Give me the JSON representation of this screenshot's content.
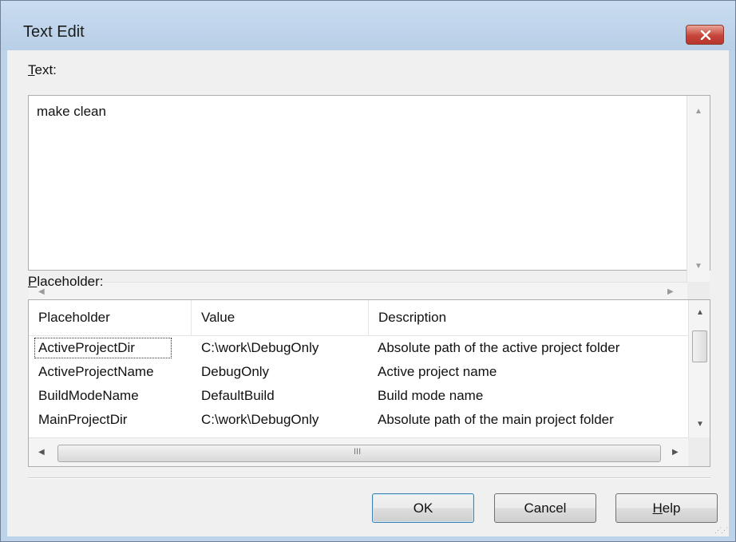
{
  "window": {
    "title": "Text Edit"
  },
  "text_section": {
    "label_underlined": "T",
    "label_rest": "ext:",
    "content": "make clean"
  },
  "placeholder_section": {
    "label_underlined": "P",
    "label_rest": "laceholder:",
    "columns": [
      "Placeholder",
      "Value",
      "Description"
    ],
    "rows": [
      {
        "placeholder": "ActiveProjectDir",
        "value": "C:\\work\\DebugOnly",
        "description": "Absolute path of the active project folder"
      },
      {
        "placeholder": "ActiveProjectName",
        "value": "DebugOnly",
        "description": "Active project name"
      },
      {
        "placeholder": "BuildModeName",
        "value": "DefaultBuild",
        "description": "Build mode name"
      },
      {
        "placeholder": "MainProjectDir",
        "value": "C:\\work\\DebugOnly",
        "description": "Absolute path of the main project folder"
      }
    ],
    "scroll_thumb_glyph": "III"
  },
  "buttons": {
    "ok": "OK",
    "cancel": "Cancel",
    "help_underlined": "H",
    "help_rest": "elp"
  },
  "colors": {
    "frame": "#bcd3ea",
    "close_button": "#c6453a",
    "default_button_border": "#3c7fb1"
  }
}
